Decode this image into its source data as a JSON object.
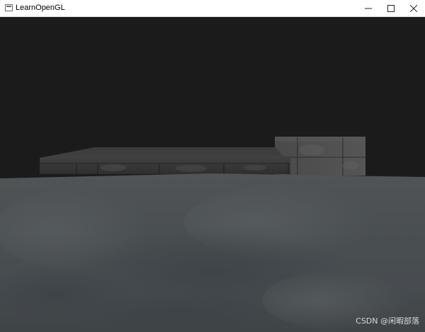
{
  "window": {
    "title": "LearnOpenGL",
    "controls": [
      {
        "name": "minimize-button",
        "icon": "minimize-icon"
      },
      {
        "name": "maximize-button",
        "icon": "maximize-icon"
      },
      {
        "name": "close-button",
        "icon": "close-icon"
      }
    ]
  },
  "scene": {
    "background_color": "#1b1b1b",
    "floor_color": "#4a4d4f",
    "cube_color": "#3a3a3a"
  },
  "watermark": "CSDN @闲暇部落"
}
